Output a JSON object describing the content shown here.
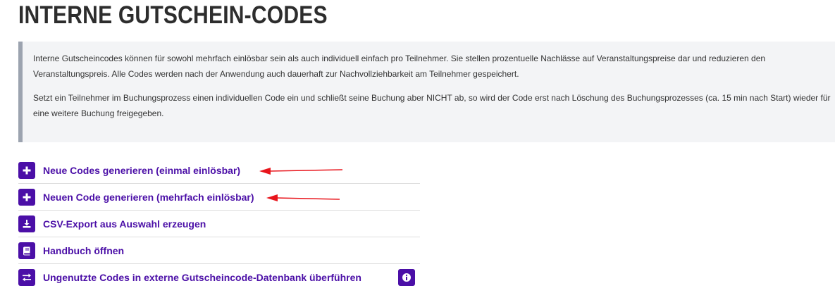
{
  "page": {
    "title": "INTERNE GUTSCHEIN-CODES"
  },
  "info": {
    "paragraph1": "Interne Gutscheincodes können für sowohl mehrfach einlösbar sein als auch individuell einfach pro Teilnehmer. Sie stellen prozentuelle Nachlässe auf Veranstaltungspreise dar und reduzieren den Veranstaltungspreis. Alle Codes werden nach der Anwendung auch dauerhaft zur Nachvollziehbarkeit am Teilnehmer gespeichert.",
    "paragraph2": "Setzt ein Teilnehmer im Buchungsprozess einen individuellen Code ein und schließt seine Buchung aber NICHT ab, so wird der Code erst nach Löschung des Buchungsprozesses (ca. 15 min nach Start) wieder für eine weitere Buchung freigegeben."
  },
  "actions": [
    {
      "label": "Neue Codes generieren (einmal einlösbar)",
      "icon": "plus-icon"
    },
    {
      "label": "Neuen Code generieren (mehrfach einlösbar)",
      "icon": "plus-icon"
    },
    {
      "label": "CSV-Export aus Auswahl erzeugen",
      "icon": "download-icon"
    },
    {
      "label": "Handbuch öffnen",
      "icon": "book-icon"
    },
    {
      "label": "Ungenutzte Codes in externe Gutscheincode-Datenbank überführen",
      "icon": "transfer-icon",
      "has_info_button": true
    }
  ],
  "colors": {
    "accent": "#4b0fa7",
    "info_border": "#9ca3af",
    "info_background": "#f3f4f6",
    "annotation_arrow": "#e8141b"
  }
}
